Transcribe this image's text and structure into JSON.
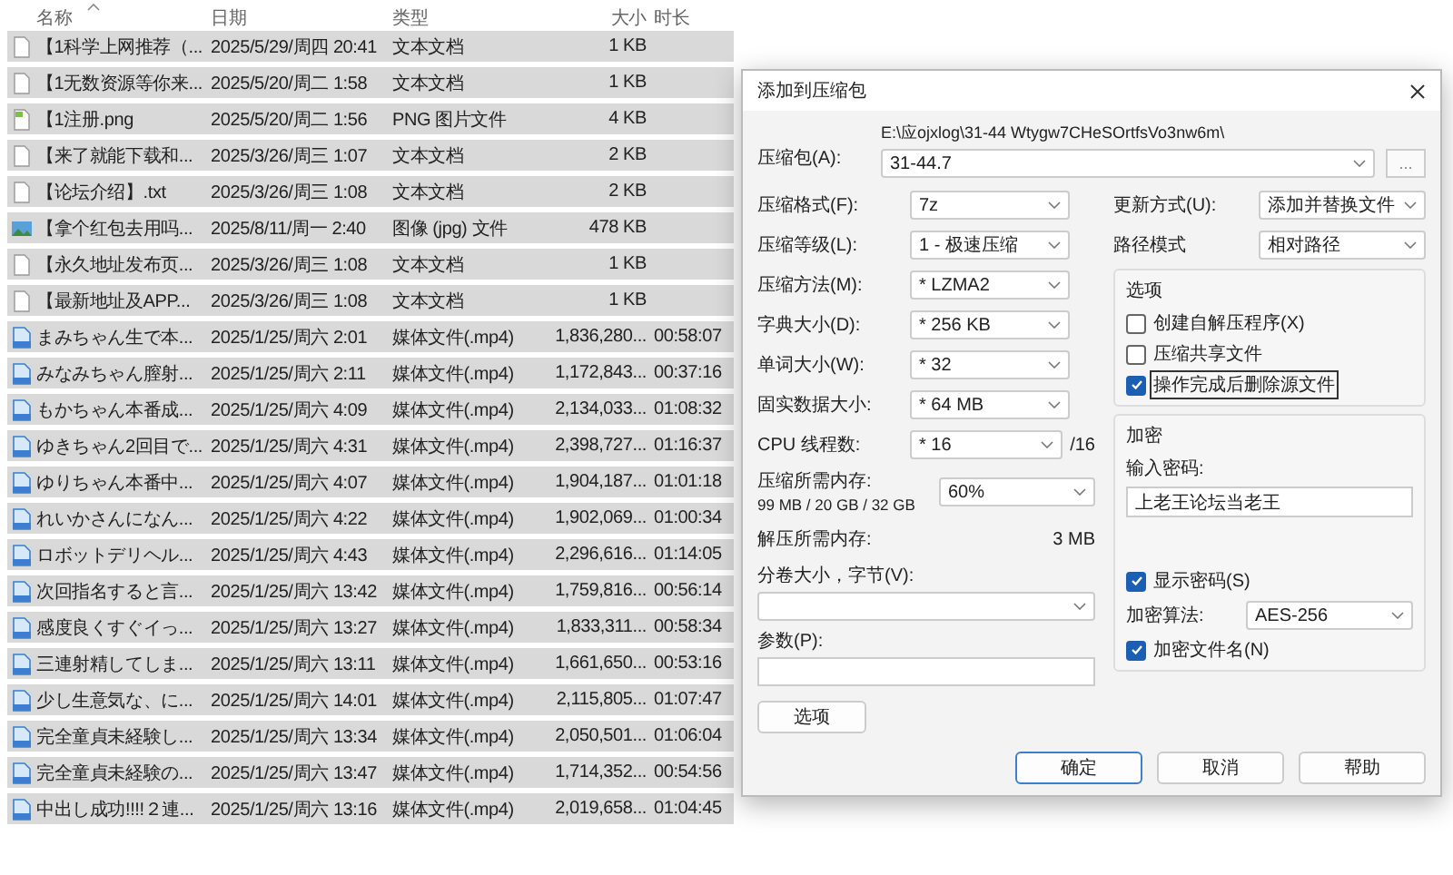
{
  "file_list": {
    "columns": [
      "名称",
      "日期",
      "类型",
      "大小",
      "时长"
    ],
    "rows": [
      {
        "kind": "text",
        "name": "【1科学上网推荐（...",
        "date": "2025/5/29/周四 20:41",
        "type": "文本文档",
        "size": "1 KB",
        "selected": true
      },
      {
        "kind": "text",
        "name": "【1无数资源等你来...",
        "date": "2025/5/20/周二 1:58",
        "type": "文本文档",
        "size": "1 KB",
        "selected": true
      },
      {
        "kind": "png",
        "name": "【1注册.png",
        "date": "2025/5/20/周二 1:56",
        "type": "PNG 图片文件",
        "size": "4 KB",
        "selected": true
      },
      {
        "kind": "text",
        "name": "【来了就能下载和...",
        "date": "2025/3/26/周三 1:07",
        "type": "文本文档",
        "size": "2 KB",
        "selected": true
      },
      {
        "kind": "text",
        "name": "【论坛介绍】.txt",
        "date": "2025/3/26/周三 1:08",
        "type": "文本文档",
        "size": "2 KB",
        "selected": true
      },
      {
        "kind": "image",
        "name": "【拿个红包去用吗...",
        "date": "2025/8/11/周一 2:40",
        "type": "图像 (jpg) 文件",
        "size": "478 KB",
        "selected": true
      },
      {
        "kind": "text",
        "name": "【永久地址发布页...",
        "date": "2025/3/26/周三 1:08",
        "type": "文本文档",
        "size": "1 KB",
        "selected": true
      },
      {
        "kind": "text",
        "name": "【最新地址及APP...",
        "date": "2025/3/26/周三 1:08",
        "type": "文本文档",
        "size": "1 KB",
        "selected": true
      },
      {
        "kind": "video",
        "name": "まみちゃん生で本...",
        "date": "2025/1/25/周六 2:01",
        "type": "媒体文件(.mp4)",
        "size": "1,836,280...",
        "duration": "00:58:07",
        "selected": true
      },
      {
        "kind": "video",
        "name": "みなみちゃん膣射...",
        "date": "2025/1/25/周六 2:11",
        "type": "媒体文件(.mp4)",
        "size": "1,172,843...",
        "duration": "00:37:16",
        "selected": true
      },
      {
        "kind": "video",
        "name": "もかちゃん本番成...",
        "date": "2025/1/25/周六 4:09",
        "type": "媒体文件(.mp4)",
        "size": "2,134,033...",
        "duration": "01:08:32",
        "selected": true
      },
      {
        "kind": "video",
        "name": "ゆきちゃん2回目で...",
        "date": "2025/1/25/周六 4:31",
        "type": "媒体文件(.mp4)",
        "size": "2,398,727...",
        "duration": "01:16:37",
        "selected": true
      },
      {
        "kind": "video",
        "name": "ゆりちゃん本番中...",
        "date": "2025/1/25/周六 4:07",
        "type": "媒体文件(.mp4)",
        "size": "1,904,187...",
        "duration": "01:01:18",
        "selected": true
      },
      {
        "kind": "video",
        "name": "れいかさんになん...",
        "date": "2025/1/25/周六 4:22",
        "type": "媒体文件(.mp4)",
        "size": "1,902,069...",
        "duration": "01:00:34",
        "selected": true
      },
      {
        "kind": "video",
        "name": "ロボットデリヘル...",
        "date": "2025/1/25/周六 4:43",
        "type": "媒体文件(.mp4)",
        "size": "2,296,616...",
        "duration": "01:14:05",
        "selected": true
      },
      {
        "kind": "video",
        "name": "次回指名すると言...",
        "date": "2025/1/25/周六 13:42",
        "type": "媒体文件(.mp4)",
        "size": "1,759,816...",
        "duration": "00:56:14",
        "selected": true
      },
      {
        "kind": "video",
        "name": "感度良くすぐイっ...",
        "date": "2025/1/25/周六 13:27",
        "type": "媒体文件(.mp4)",
        "size": "1,833,311...",
        "duration": "00:58:34",
        "selected": true
      },
      {
        "kind": "video",
        "name": "三連射精してしま...",
        "date": "2025/1/25/周六 13:11",
        "type": "媒体文件(.mp4)",
        "size": "1,661,650...",
        "duration": "00:53:16",
        "selected": true
      },
      {
        "kind": "video",
        "name": "少し生意気な、に...",
        "date": "2025/1/25/周六 14:01",
        "type": "媒体文件(.mp4)",
        "size": "2,115,805...",
        "duration": "01:07:47",
        "selected": true
      },
      {
        "kind": "video",
        "name": "完全童貞未経験し...",
        "date": "2025/1/25/周六 13:34",
        "type": "媒体文件(.mp4)",
        "size": "2,050,501...",
        "duration": "01:06:04",
        "selected": true
      },
      {
        "kind": "video",
        "name": "完全童貞未経験の...",
        "date": "2025/1/25/周六 13:47",
        "type": "媒体文件(.mp4)",
        "size": "1,714,352...",
        "duration": "00:54:56",
        "selected": true
      },
      {
        "kind": "video",
        "name": "中出し成功!!!!２連...",
        "date": "2025/1/25/周六 13:16",
        "type": "媒体文件(.mp4)",
        "size": "2,019,658...",
        "duration": "01:04:45",
        "selected": true
      }
    ]
  },
  "dialog": {
    "title": "添加到压缩包",
    "archive": {
      "label": "压缩包(A):",
      "path": "E:\\应ojxlog\\31-44 Wtygw7CHeSOrtfsVo3nw6m\\",
      "value": "31-44.7",
      "browse": "..."
    },
    "left_fields": [
      {
        "kind": "select",
        "label": "压缩格式(F):",
        "value": "7z"
      },
      {
        "kind": "select",
        "label": "压缩等级(L):",
        "value": "1 - 极速压缩"
      },
      {
        "kind": "select",
        "label": "压缩方法(M):",
        "value": "* LZMA2"
      },
      {
        "kind": "select",
        "label": "字典大小(D):",
        "value": "* 256 KB"
      },
      {
        "kind": "select",
        "label": "单词大小(W):",
        "value": "* 32"
      },
      {
        "kind": "select",
        "label": "固实数据大小:",
        "value": "* 64 MB"
      },
      {
        "kind": "select_suffix",
        "label": "CPU 线程数:",
        "value": "* 16",
        "suffix": "/16"
      },
      {
        "kind": "memory",
        "label": "压缩所需内存:",
        "detail": "99 MB / 20 GB / 32 GB",
        "value": "60%"
      },
      {
        "kind": "readout",
        "label": "解压所需内存:",
        "value": "3 MB"
      },
      {
        "kind": "stacked_select",
        "label": "分卷大小，字节(V):"
      },
      {
        "kind": "stacked_input",
        "label": "参数(P):"
      }
    ],
    "options_button": "选项",
    "right_fields": [
      {
        "label": "更新方式(U):",
        "value": "添加并替换文件"
      },
      {
        "label": "路径模式",
        "value": "相对路径"
      }
    ],
    "options_group": {
      "title": "选项",
      "checkboxes": [
        {
          "label": "创建自解压程序(X)",
          "checked": false,
          "focused": false
        },
        {
          "label": "压缩共享文件",
          "checked": false,
          "focused": false
        },
        {
          "label": "操作完成后删除源文件",
          "checked": true,
          "focused": true
        }
      ]
    },
    "encryption": {
      "title": "加密",
      "password_label": "输入密码:",
      "password": "上老王论坛当老王",
      "show_password": {
        "label": "显示密码(S)",
        "checked": true
      },
      "method_label": "加密算法:",
      "method": "AES-256",
      "encrypt_names": {
        "label": "加密文件名(N)",
        "checked": true
      }
    },
    "buttons": [
      {
        "label": "确定",
        "default": true
      },
      {
        "label": "取消",
        "default": false
      },
      {
        "label": "帮助",
        "default": false
      }
    ]
  }
}
